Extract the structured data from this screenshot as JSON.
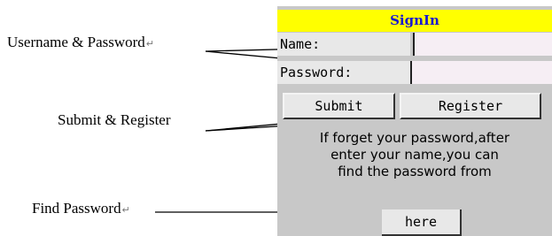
{
  "callouts": {
    "credentials": "Username & Password",
    "buttons": "Submit & Register",
    "find_password": "Find Password"
  },
  "form": {
    "title": "SignIn",
    "name_label": "Name:",
    "name_value": "",
    "password_label": "Password:",
    "password_value": "",
    "submit_label": "Submit",
    "register_label": "Register",
    "help_lines": [
      "If forget your password,after",
      "enter your name,you can",
      "find the password from"
    ],
    "here_label": "here"
  },
  "colors": {
    "header_bg": "#ffff00",
    "header_text": "#1a1ad0",
    "panel_bg": "#c8c8c8"
  }
}
